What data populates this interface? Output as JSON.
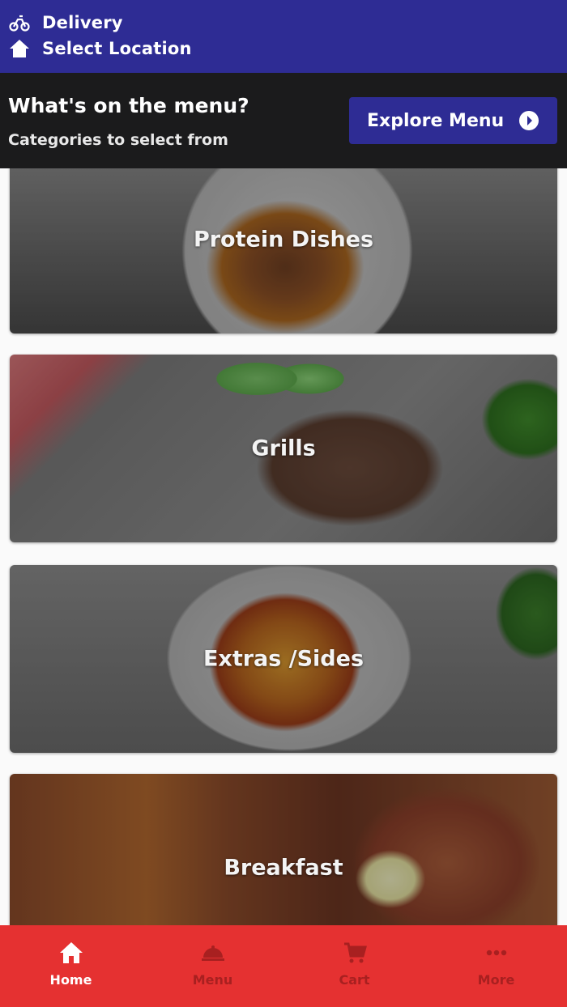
{
  "header": {
    "delivery_label": "Delivery",
    "location_label": "Select Location",
    "icons": [
      "bike-icon",
      "home-icon"
    ],
    "bg_color": "#2e2c94"
  },
  "menu_header": {
    "title": "What's on the menu?",
    "subtitle": "Categories to select from",
    "explore_button": "Explore Menu",
    "explore_icon": "arrow-right-circle-icon",
    "bg_color": "#1b1b1c"
  },
  "categories": [
    {
      "name": "Protein Dishes"
    },
    {
      "name": "Grills"
    },
    {
      "name": "Extras /Sides"
    },
    {
      "name": "Breakfast"
    }
  ],
  "bottom_nav": {
    "bg_color": "#e53131",
    "items": [
      {
        "label": "Home",
        "icon": "home-icon",
        "active": true
      },
      {
        "label": "Menu",
        "icon": "dish-icon",
        "active": false
      },
      {
        "label": "Cart",
        "icon": "cart-icon",
        "active": false
      },
      {
        "label": "More",
        "icon": "more-icon",
        "active": false
      }
    ]
  }
}
